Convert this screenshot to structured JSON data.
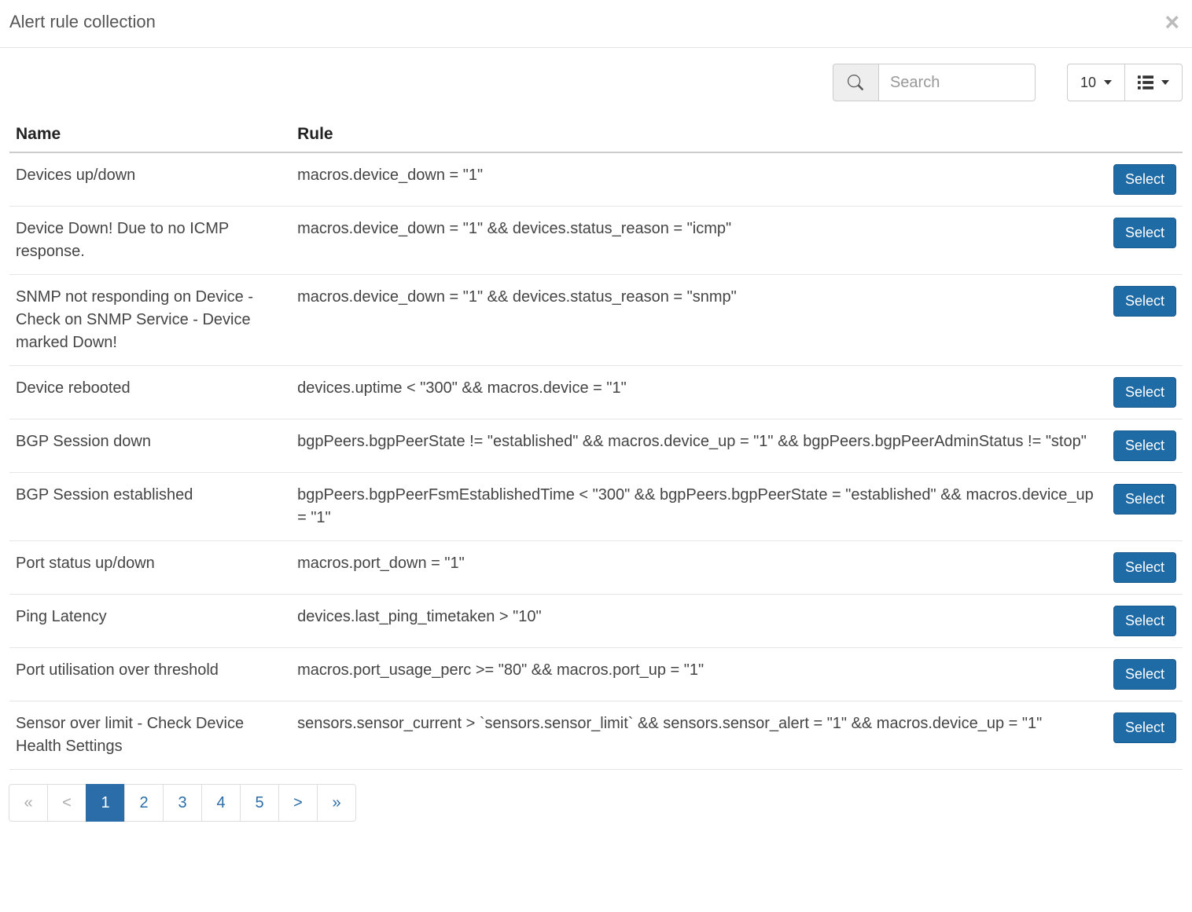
{
  "header": {
    "title": "Alert rule collection"
  },
  "toolbar": {
    "search_placeholder": "Search",
    "page_size": "10"
  },
  "table": {
    "columns": {
      "name": "Name",
      "rule": "Rule"
    },
    "action_label": "Select",
    "rows": [
      {
        "name": "Devices up/down",
        "rule": "macros.device_down = \"1\""
      },
      {
        "name": "Device Down! Due to no ICMP response.",
        "rule": "macros.device_down = \"1\" && devices.status_reason = \"icmp\""
      },
      {
        "name": "SNMP not responding on Device - Check on SNMP Service - Device marked Down!",
        "rule": "macros.device_down = \"1\" && devices.status_reason = \"snmp\""
      },
      {
        "name": "Device rebooted",
        "rule": "devices.uptime < \"300\" && macros.device = \"1\""
      },
      {
        "name": "BGP Session down",
        "rule": "bgpPeers.bgpPeerState != \"established\" && macros.device_up = \"1\" && bgpPeers.bgpPeerAdminStatus != \"stop\""
      },
      {
        "name": "BGP Session established",
        "rule": "bgpPeers.bgpPeerFsmEstablishedTime < \"300\" && bgpPeers.bgpPeerState = \"established\" && macros.device_up = \"1\""
      },
      {
        "name": "Port status up/down",
        "rule": "macros.port_down = \"1\""
      },
      {
        "name": "Ping Latency",
        "rule": "devices.last_ping_timetaken > \"10\""
      },
      {
        "name": "Port utilisation over threshold",
        "rule": "macros.port_usage_perc >= \"80\" && macros.port_up = \"1\""
      },
      {
        "name": "Sensor over limit - Check Device Health Settings",
        "rule": "sensors.sensor_current > `sensors.sensor_limit` && sensors.sensor_alert = \"1\" && macros.device_up = \"1\""
      }
    ]
  },
  "pagination": {
    "first": "«",
    "prev": "<",
    "next": ">",
    "last": "»",
    "pages": [
      "1",
      "2",
      "3",
      "4",
      "5"
    ],
    "active_index": 0
  }
}
